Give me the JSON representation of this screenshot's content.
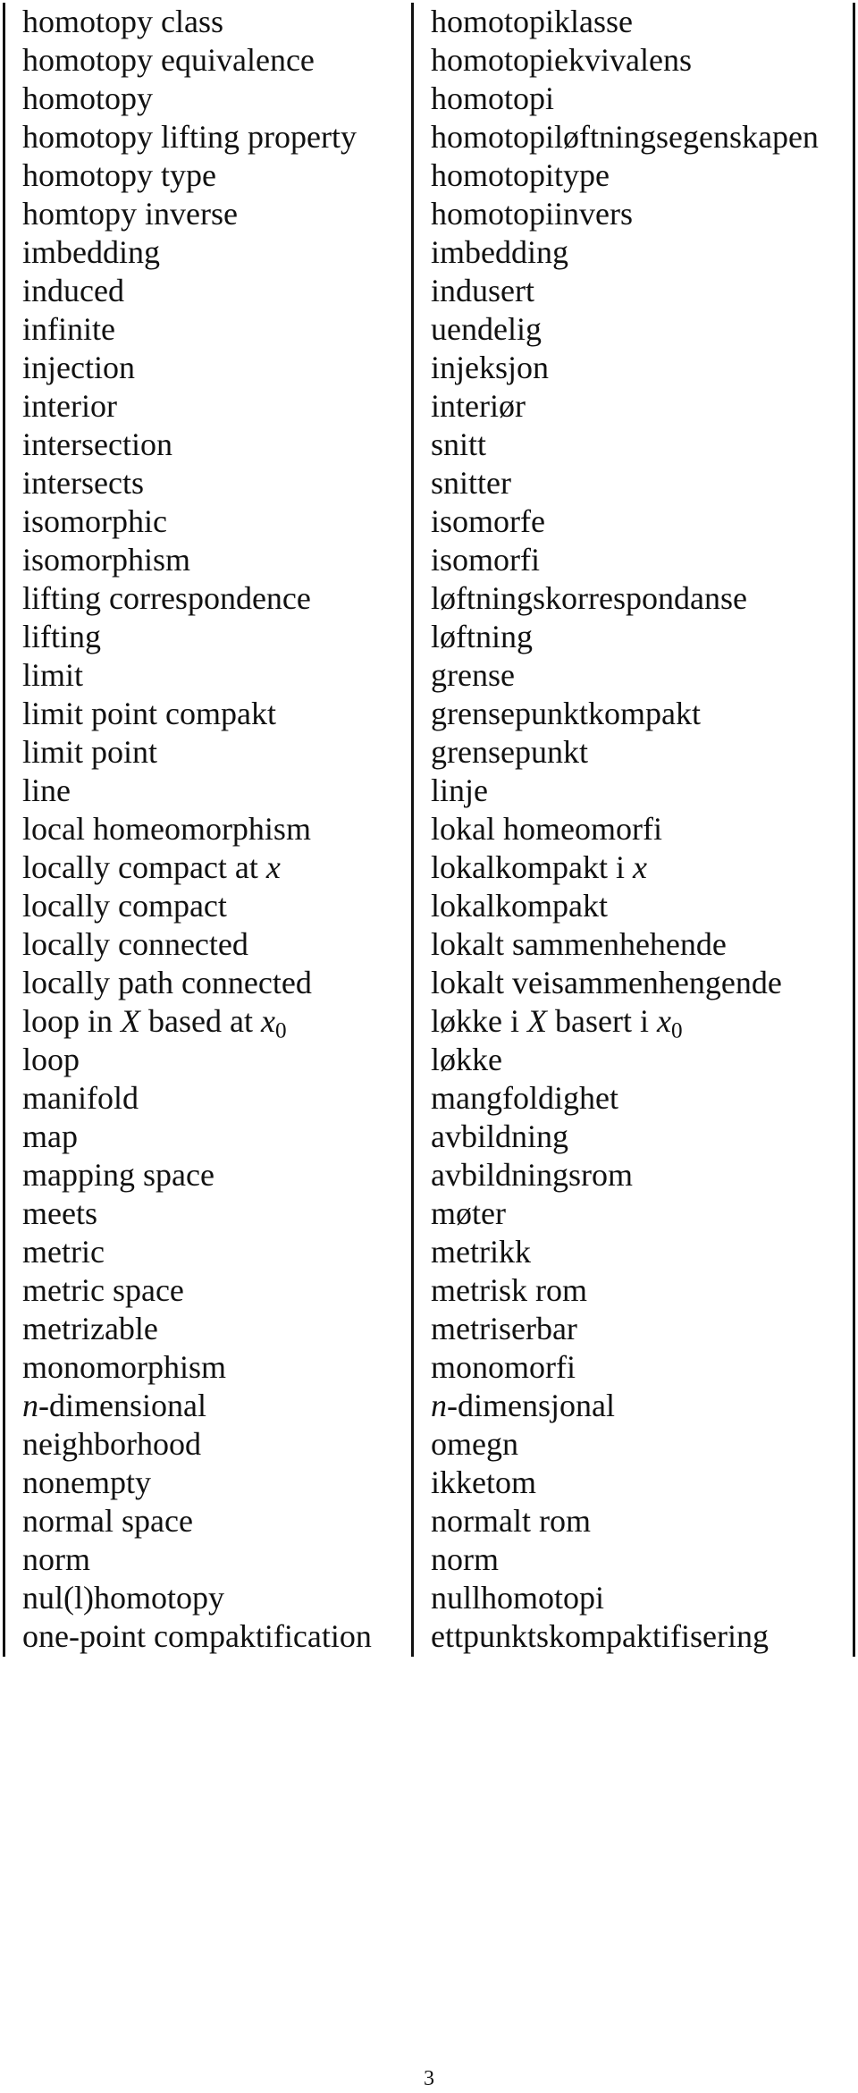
{
  "glossary": {
    "rows": [
      {
        "en": "homotopy class",
        "no": "homotopiklasse"
      },
      {
        "en": "homotopy equivalence",
        "no": "homotopiekvivalens"
      },
      {
        "en": "homotopy",
        "no": "homotopi"
      },
      {
        "en": "homotopy lifting property",
        "no": "homotopiløftningsegenskapen"
      },
      {
        "en": "homotopy type",
        "no": "homotopitype"
      },
      {
        "en": "homtopy inverse",
        "no": "homotopiinvers"
      },
      {
        "en": "imbedding",
        "no": "imbedding"
      },
      {
        "en": "induced",
        "no": "indusert"
      },
      {
        "en": "infinite",
        "no": "uendelig"
      },
      {
        "en": "injection",
        "no": "injeksjon"
      },
      {
        "en": "interior",
        "no": "interiør"
      },
      {
        "en": "intersection",
        "no": "snitt"
      },
      {
        "en": "intersects",
        "no": "snitter"
      },
      {
        "en": "isomorphic",
        "no": "isomorfe"
      },
      {
        "en": "isomorphism",
        "no": "isomorfi"
      },
      {
        "en": "lifting correspondence",
        "no": "løftningskorrespondanse"
      },
      {
        "en": "lifting",
        "no": "løftning"
      },
      {
        "en": "limit",
        "no": "grense"
      },
      {
        "en": "limit point compakt",
        "no": "grensepunktkompakt"
      },
      {
        "en": "limit point",
        "no": "grensepunkt"
      },
      {
        "en": "line",
        "no": "linje"
      },
      {
        "en": "local homeomorphism",
        "no": "lokal homeomorfi"
      },
      {
        "en_parts": [
          {
            "t": "locally compact at "
          },
          {
            "t": "x",
            "math": true
          }
        ],
        "no_parts": [
          {
            "t": "lokalkompakt i "
          },
          {
            "t": "x",
            "math": true
          }
        ]
      },
      {
        "en": "locally compact",
        "no": "lokalkompakt"
      },
      {
        "en": "locally connected",
        "no": "lokalt sammenhehende"
      },
      {
        "en": "locally path connected",
        "no": "lokalt veisammenhengende"
      },
      {
        "en_parts": [
          {
            "t": "loop in "
          },
          {
            "t": "X",
            "math": true
          },
          {
            "t": " based at "
          },
          {
            "t": "x",
            "math": true
          },
          {
            "t": "0",
            "sub": true
          }
        ],
        "no_parts": [
          {
            "t": "løkke i "
          },
          {
            "t": "X",
            "math": true
          },
          {
            "t": " basert i "
          },
          {
            "t": "x",
            "math": true
          },
          {
            "t": "0",
            "sub": true
          }
        ]
      },
      {
        "en": "loop",
        "no": "løkke"
      },
      {
        "en": "manifold",
        "no": "mangfoldighet"
      },
      {
        "en": "map",
        "no": "avbildning"
      },
      {
        "en": "mapping space",
        "no": "avbildningsrom"
      },
      {
        "en": "meets",
        "no": "møter"
      },
      {
        "en": "metric",
        "no": "metrikk"
      },
      {
        "en": "metric space",
        "no": "metrisk rom"
      },
      {
        "en": "metrizable",
        "no": "metriserbar"
      },
      {
        "en": "monomorphism",
        "no": "monomorfi"
      },
      {
        "en_parts": [
          {
            "t": "n",
            "math": true
          },
          {
            "t": "-dimensional"
          }
        ],
        "no_parts": [
          {
            "t": "n",
            "math": true
          },
          {
            "t": "-dimensjonal"
          }
        ]
      },
      {
        "en": "neighborhood",
        "no": "omegn"
      },
      {
        "en": "nonempty",
        "no": "ikketom"
      },
      {
        "en": "normal space",
        "no": "normalt rom"
      },
      {
        "en": "norm",
        "no": "norm"
      },
      {
        "en": "nul(l)homotopy",
        "no": "nullhomotopi"
      },
      {
        "en": "one-point compaktification",
        "no": "ettpunktskompaktifisering"
      }
    ]
  },
  "page_number": "3"
}
